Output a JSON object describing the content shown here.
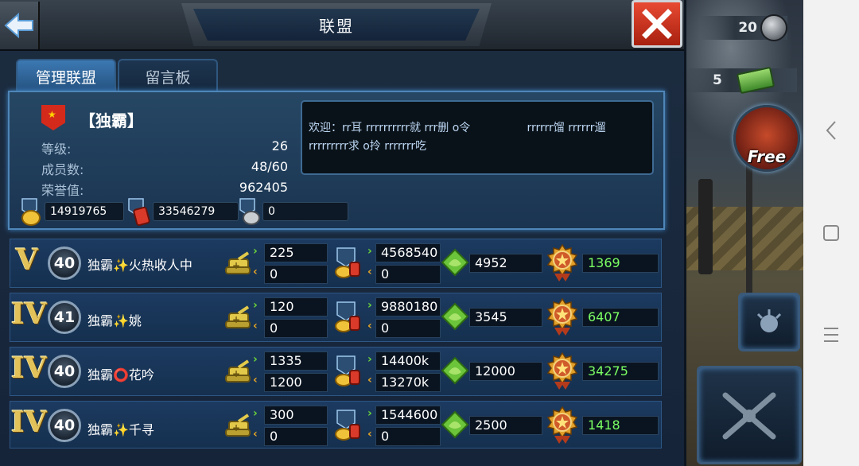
{
  "header": {
    "title": "联盟"
  },
  "tabs": [
    {
      "label": "管理联盟",
      "active": true
    },
    {
      "label": "留言板",
      "active": false
    }
  ],
  "guild": {
    "name": "【独霸】",
    "stats": [
      {
        "label": "等级:",
        "value": "26"
      },
      {
        "label": "成员数:",
        "value": "48/60"
      },
      {
        "label": "荣誉值:",
        "value": "962405"
      }
    ],
    "resources": [
      {
        "icon": "gold-coin-icon",
        "value": "14919765"
      },
      {
        "icon": "fuel-barrel-icon",
        "value": "33546279"
      },
      {
        "icon": "silver-coin-icon",
        "value": "0"
      }
    ],
    "welcome_line1": "欢迎：rr耳 rrrrrrrrrr就 rrr删 o令                rrrrrr馏 rrrrrr遛",
    "welcome_line2": "rrrrrrrrr求 o拎 rrrrrrr吃"
  },
  "members": [
    {
      "rank": "V",
      "level": "40",
      "name": "独霸✨火热收人中",
      "donate_in": "225",
      "donate_out": "0",
      "res_in": "4568540",
      "res_out": "0",
      "wreath": "4952",
      "medal": "1369"
    },
    {
      "rank": "IV",
      "level": "41",
      "name": "独霸✨姚",
      "donate_in": "120",
      "donate_out": "0",
      "res_in": "9880180",
      "res_out": "0",
      "wreath": "3545",
      "medal": "6407"
    },
    {
      "rank": "IV",
      "level": "40",
      "name": "独霸⭕花吟",
      "donate_in": "1335",
      "donate_out": "1200",
      "res_in": "14400k",
      "res_out": "13270k",
      "wreath": "12000",
      "medal": "34275"
    },
    {
      "rank": "IV",
      "level": "40",
      "name": "独霸✨千寻",
      "donate_in": "300",
      "donate_out": "0",
      "res_in": "1544600",
      "res_out": "0",
      "wreath": "2500",
      "medal": "1418"
    }
  ],
  "hud": {
    "coins": "20",
    "cash": "5",
    "free_label": "Free"
  },
  "colors": {
    "accent_blue": "#4f86b8",
    "close_red": "#d8321c",
    "medal_green": "#7bff63",
    "rank_gold": "#e3c25a"
  }
}
